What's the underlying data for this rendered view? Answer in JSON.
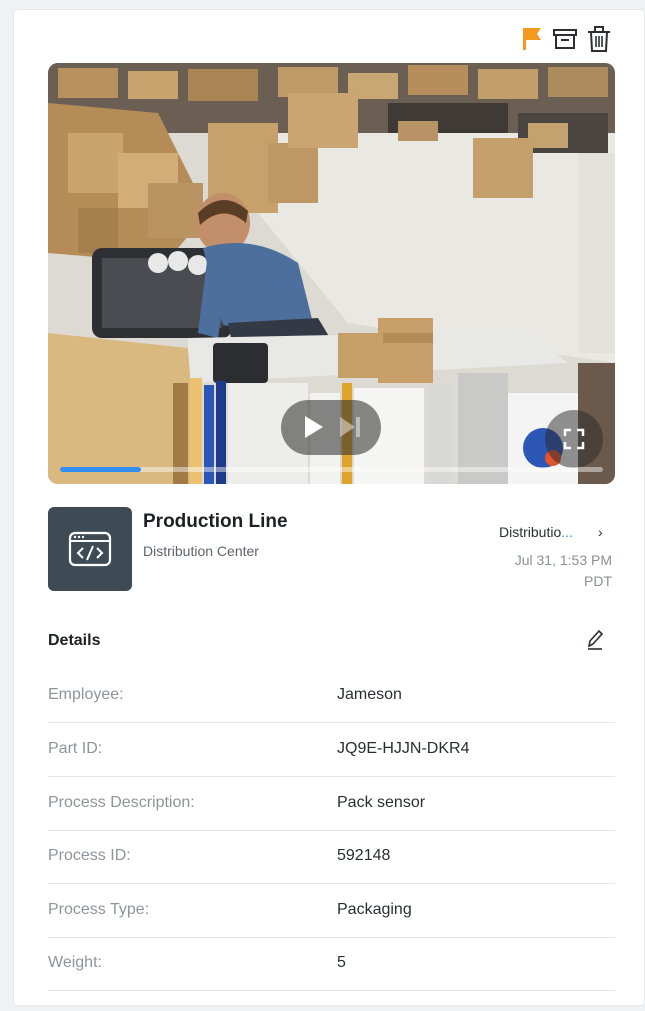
{
  "camera": {
    "name": "Production Line",
    "site": "Distribution Center",
    "location_link_prefix": "Distributio",
    "location_link_ellipsis": "...",
    "chevron": "›",
    "timestamp_line1": "Jul 31, 1:53 PM",
    "timestamp_line2": "PDT",
    "thumbnail_icon": "code-window-icon"
  },
  "actions": [
    {
      "name": "flag",
      "icon": "flag-icon",
      "color": "#f39a1e"
    },
    {
      "name": "archive",
      "icon": "archive-icon",
      "color": "#2b2f33"
    },
    {
      "name": "delete",
      "icon": "trash-icon",
      "color": "#2b2f33"
    }
  ],
  "player": {
    "progress_fraction": 0.15,
    "accent": "#2e8ff0",
    "controls": [
      "play-icon",
      "skip-next-icon",
      "fullscreen-icon"
    ]
  },
  "details": {
    "title": "Details",
    "edit_icon": "pencil-icon",
    "rows": [
      {
        "label": "Employee:",
        "value": "Jameson"
      },
      {
        "label": "Part ID:",
        "value": "JQ9E-HJJN-DKR4"
      },
      {
        "label": "Process Description:",
        "value": "Pack sensor"
      },
      {
        "label": "Process ID:",
        "value": "592148"
      },
      {
        "label": "Process Type:",
        "value": "Packaging"
      },
      {
        "label": "Weight:",
        "value": "5"
      }
    ]
  }
}
